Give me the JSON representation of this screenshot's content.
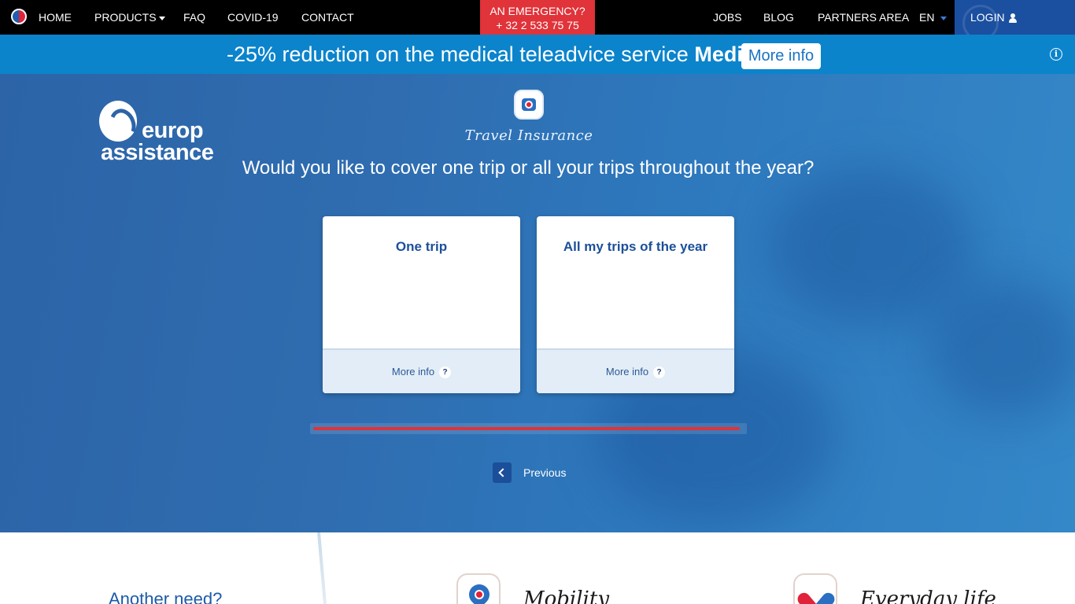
{
  "nav": {
    "left_items": [
      {
        "label": "HOME"
      },
      {
        "label": "PRODUCTS"
      },
      {
        "label": "FAQ"
      },
      {
        "label": "COVID-19"
      },
      {
        "label": "CONTACT"
      }
    ],
    "emergency": {
      "line1": "AN EMERGENCY?",
      "line2": "+ 32 2 533 75 75"
    },
    "right_items": [
      {
        "label": "JOBS"
      },
      {
        "label": "BLOG"
      },
      {
        "label": "PARTNERS AREA"
      }
    ],
    "language": "EN",
    "login": "LOGIN"
  },
  "promo": {
    "text": "-25% reduction on the medical teleadvice service",
    "highlight": "Medicall",
    "suffix": " ?",
    "button": "More info"
  },
  "hero": {
    "logo_line1": "europ",
    "logo_line2": "assistance",
    "product_name": "Travel Insurance",
    "question": "Would you like to cover one trip or all your trips throughout the year?",
    "options": [
      {
        "title": "One trip",
        "more": "More info",
        "help": "?"
      },
      {
        "title": "All my trips of the year",
        "more": "More info",
        "help": "?"
      }
    ],
    "progress": 0.99,
    "previous": "Previous"
  },
  "bottom": {
    "need_title": "Another need?",
    "categories": [
      {
        "title": "Mobility",
        "icon": "location-pin-icon"
      },
      {
        "title": "Everyday life",
        "icon": "heart-icon"
      }
    ]
  },
  "colors": {
    "nav_bg": "#000000",
    "emergency": "#e0333a",
    "promo_bg": "#0b84cc",
    "hero_bg": "#2e6db0",
    "brand_blue": "#1c4f99"
  }
}
